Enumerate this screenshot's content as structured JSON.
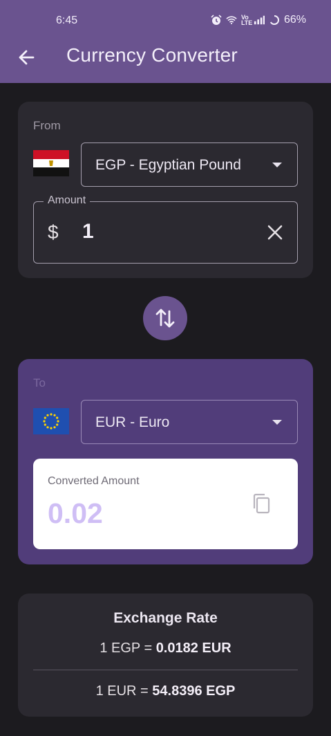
{
  "status_bar": {
    "time": "6:45",
    "battery": "66%",
    "icons": [
      "alarm-icon",
      "wifi-icon",
      "volte-icon",
      "signal-icon",
      "battery-icon"
    ],
    "volte_label": "Vo LTE"
  },
  "app_bar": {
    "title": "Currency Converter",
    "back_icon": "arrow-back-icon"
  },
  "from": {
    "label": "From",
    "flag": "egypt-flag",
    "currency": "EGP - Egyptian Pound",
    "amount_label": "Amount",
    "currency_symbol": "$",
    "amount_value": "1",
    "clear_icon": "close-icon"
  },
  "swap": {
    "icon": "swap-vertical-icon"
  },
  "to": {
    "label": "To",
    "flag": "eu-flag",
    "currency": "EUR - Euro",
    "converted_label": "Converted Amount",
    "converted_value": "0.02",
    "copy_icon": "copy-icon"
  },
  "exchange_rate": {
    "title": "Exchange Rate",
    "line1_prefix": "1 EGP = ",
    "line1_value": "0.0182 EUR",
    "line2_prefix": "1 EUR = ",
    "line2_value": "54.8396 EGP"
  },
  "colors": {
    "app_bar": "#6a538f",
    "background": "#1c1b1f",
    "card": "#2b2930",
    "to_card": "#513d7a",
    "accent_value": "#cfbef5"
  }
}
